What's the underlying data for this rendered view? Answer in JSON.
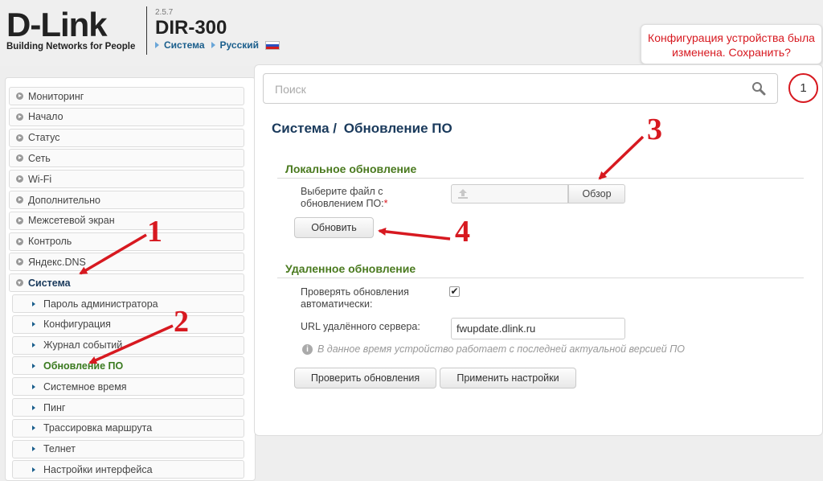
{
  "header": {
    "logo": "D-Link",
    "logo_sub": "Building Networks for People",
    "version": "2.5.7",
    "model": "DIR-300",
    "crumb_section": "Система",
    "crumb_language": "Русский",
    "notice": "Конфигурация устройства была изменена. Сохранить?"
  },
  "colors": {
    "accent_red": "#d71920",
    "title_blue": "#1a3a5c",
    "section_green": "#4a7a1f",
    "active_green": "#3a7a1f"
  },
  "sidebar": {
    "items": [
      {
        "label": "Мониторинг",
        "icon": "chevron-right-icon"
      },
      {
        "label": "Начало",
        "icon": "chevron-right-icon"
      },
      {
        "label": "Статус",
        "icon": "chevron-right-icon"
      },
      {
        "label": "Сеть",
        "icon": "chevron-right-icon"
      },
      {
        "label": "Wi-Fi",
        "icon": "chevron-right-icon"
      },
      {
        "label": "Дополнительно",
        "icon": "chevron-right-icon"
      },
      {
        "label": "Межсетевой экран",
        "icon": "chevron-right-icon"
      },
      {
        "label": "Контроль",
        "icon": "chevron-right-icon"
      },
      {
        "label": "Яндекс.DNS",
        "icon": "chevron-right-icon"
      },
      {
        "label": "Система",
        "icon": "chevron-down-icon"
      }
    ],
    "subitems": [
      {
        "label": "Пароль администратора"
      },
      {
        "label": "Конфигурация"
      },
      {
        "label": "Журнал событий"
      },
      {
        "label": "Обновление ПО"
      },
      {
        "label": "Системное время"
      },
      {
        "label": "Пинг"
      },
      {
        "label": "Трассировка маршрута"
      },
      {
        "label": "Телнет"
      },
      {
        "label": "Настройки интерфейса"
      }
    ]
  },
  "search": {
    "placeholder": "Поиск",
    "icon": "search-icon"
  },
  "step_badge": "1",
  "main": {
    "title_section": "Система /",
    "title_page": "Обновление ПО",
    "local": {
      "title": "Локальное обновление",
      "file_label_1": "Выберите файл с",
      "file_label_2": "обновлением ПО:",
      "required_mark": "*",
      "browse_label": "Обзор",
      "update_label": "Обновить"
    },
    "remote": {
      "title": "Удаленное обновление",
      "auto_label_1": "Проверять обновления",
      "auto_label_2": "автоматически:",
      "auto_checked": true,
      "checkmark": "✔",
      "url_label": "URL удалённого сервера:",
      "url_value": "fwupdate.dlink.ru",
      "info_text": "В данное время устройство работает с последней актуальной версией ПО",
      "check_label": "Проверить обновления",
      "apply_label": "Применить настройки"
    }
  },
  "annotations": [
    "1",
    "2",
    "3",
    "4"
  ]
}
